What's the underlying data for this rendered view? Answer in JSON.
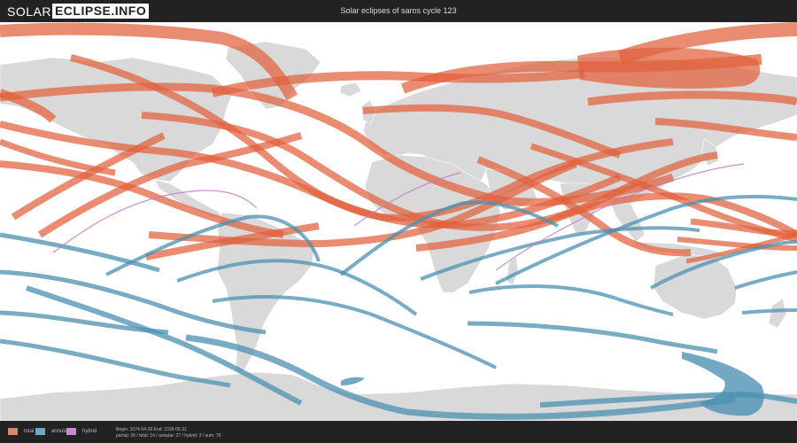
{
  "header": {
    "logo_part1": "SOLAR",
    "logo_part2": "ECLIPSE.INFO",
    "title": "Solar eclipses of saros cycle 123"
  },
  "legend": {
    "items": [
      {
        "label": "total",
        "color": "#e0846a"
      },
      {
        "label": "annular",
        "color": "#6fa7c4"
      },
      {
        "label": "hybrid",
        "color": "#c48fcf"
      }
    ]
  },
  "info": {
    "line1": "Begin: 1074-04-29 End: 2318-05-31",
    "line2": "partial: 26 / total: 14 / annular: 27 / hybrid: 3 / sum: 70"
  },
  "colors": {
    "total": "#e0603c",
    "annular": "#4a90b0",
    "hybrid": "#c07ac8",
    "land": "#d9d9d9",
    "bar": "#222222"
  }
}
